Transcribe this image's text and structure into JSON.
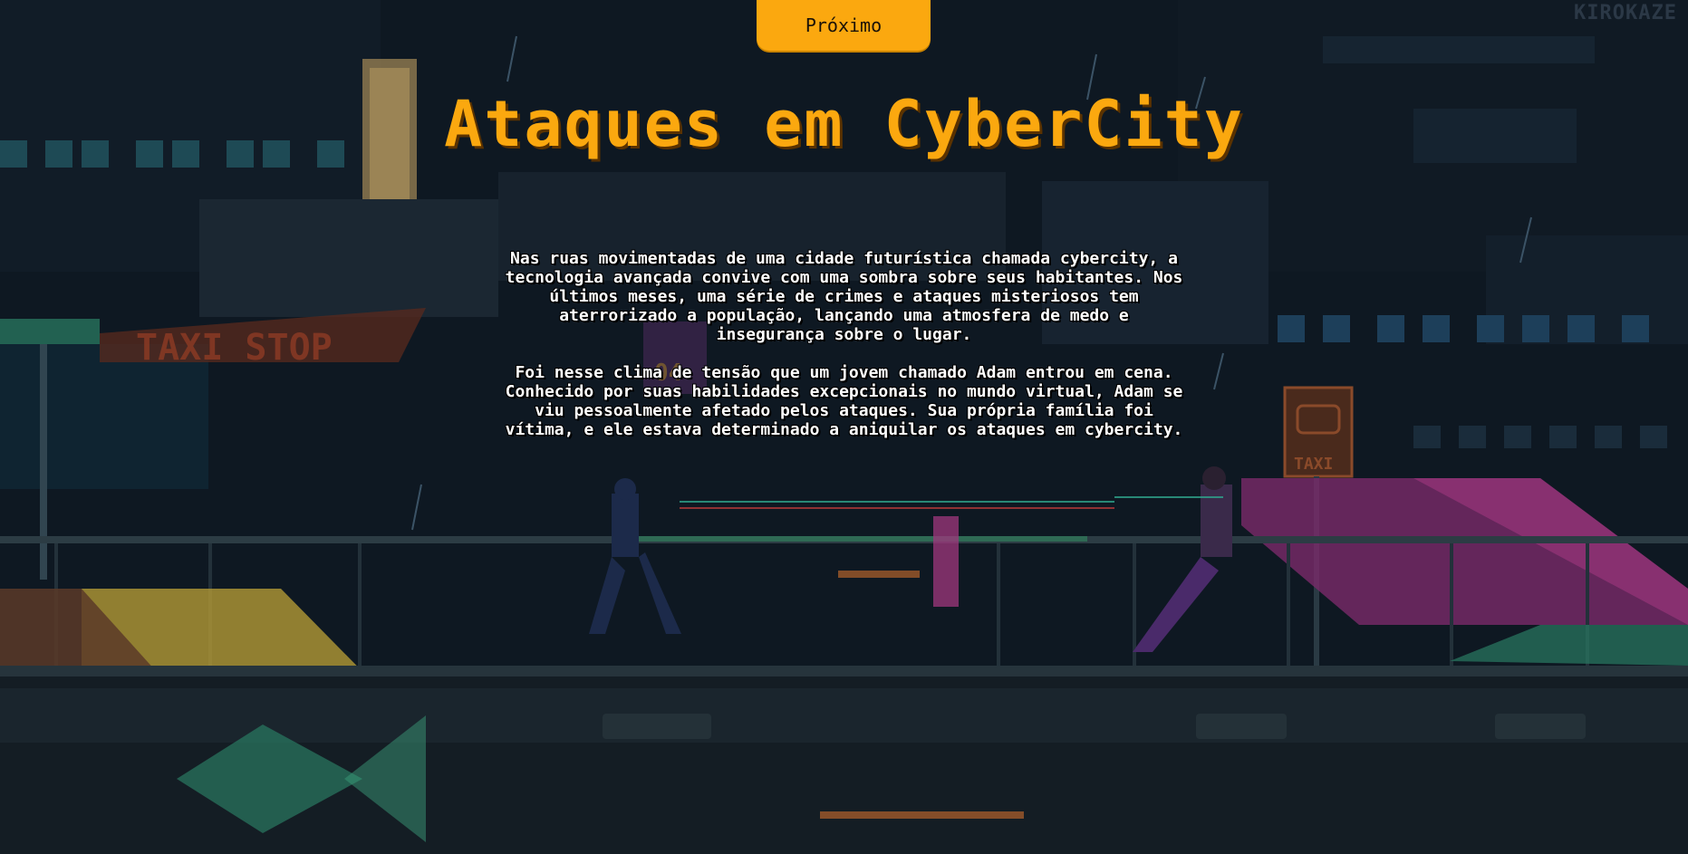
{
  "navigation": {
    "next_label": "Próximo"
  },
  "page": {
    "title": "Ataques em CyberCity",
    "paragraphs": [
      "Nas ruas movimentadas de uma cidade futurística chamada cybercity, a tecnologia avançada convive com uma sombra sobre seus habitantes. Nos últimos meses, uma série de crimes e ataques misteriosos tem aterrorizado a população, lançando uma atmosfera de medo e insegurança sobre o lugar.",
      "Foi nesse clima de tensão que um jovem chamado Adam entrou em cena. Conhecido por suas habilidades excepcionais no mundo virtual, Adam se viu pessoalmente afetado pelos ataques. Sua própria família foi vítima, e ele estava determinado a aniquilar os ataques em cybercity."
    ]
  },
  "background": {
    "signage": {
      "taxi_stop": "TAXI STOP",
      "taxi_sign": "TAXI",
      "neon_number": "04",
      "artist_watermark": "KIROKAZE"
    },
    "colors": {
      "accent": "#fba80f",
      "sky": "#0d1620",
      "neon_teal": "#2fa58c",
      "neon_magenta": "#a0377e",
      "neon_yellow": "#c9a83a",
      "taxi_orange": "#8a3a24"
    }
  }
}
